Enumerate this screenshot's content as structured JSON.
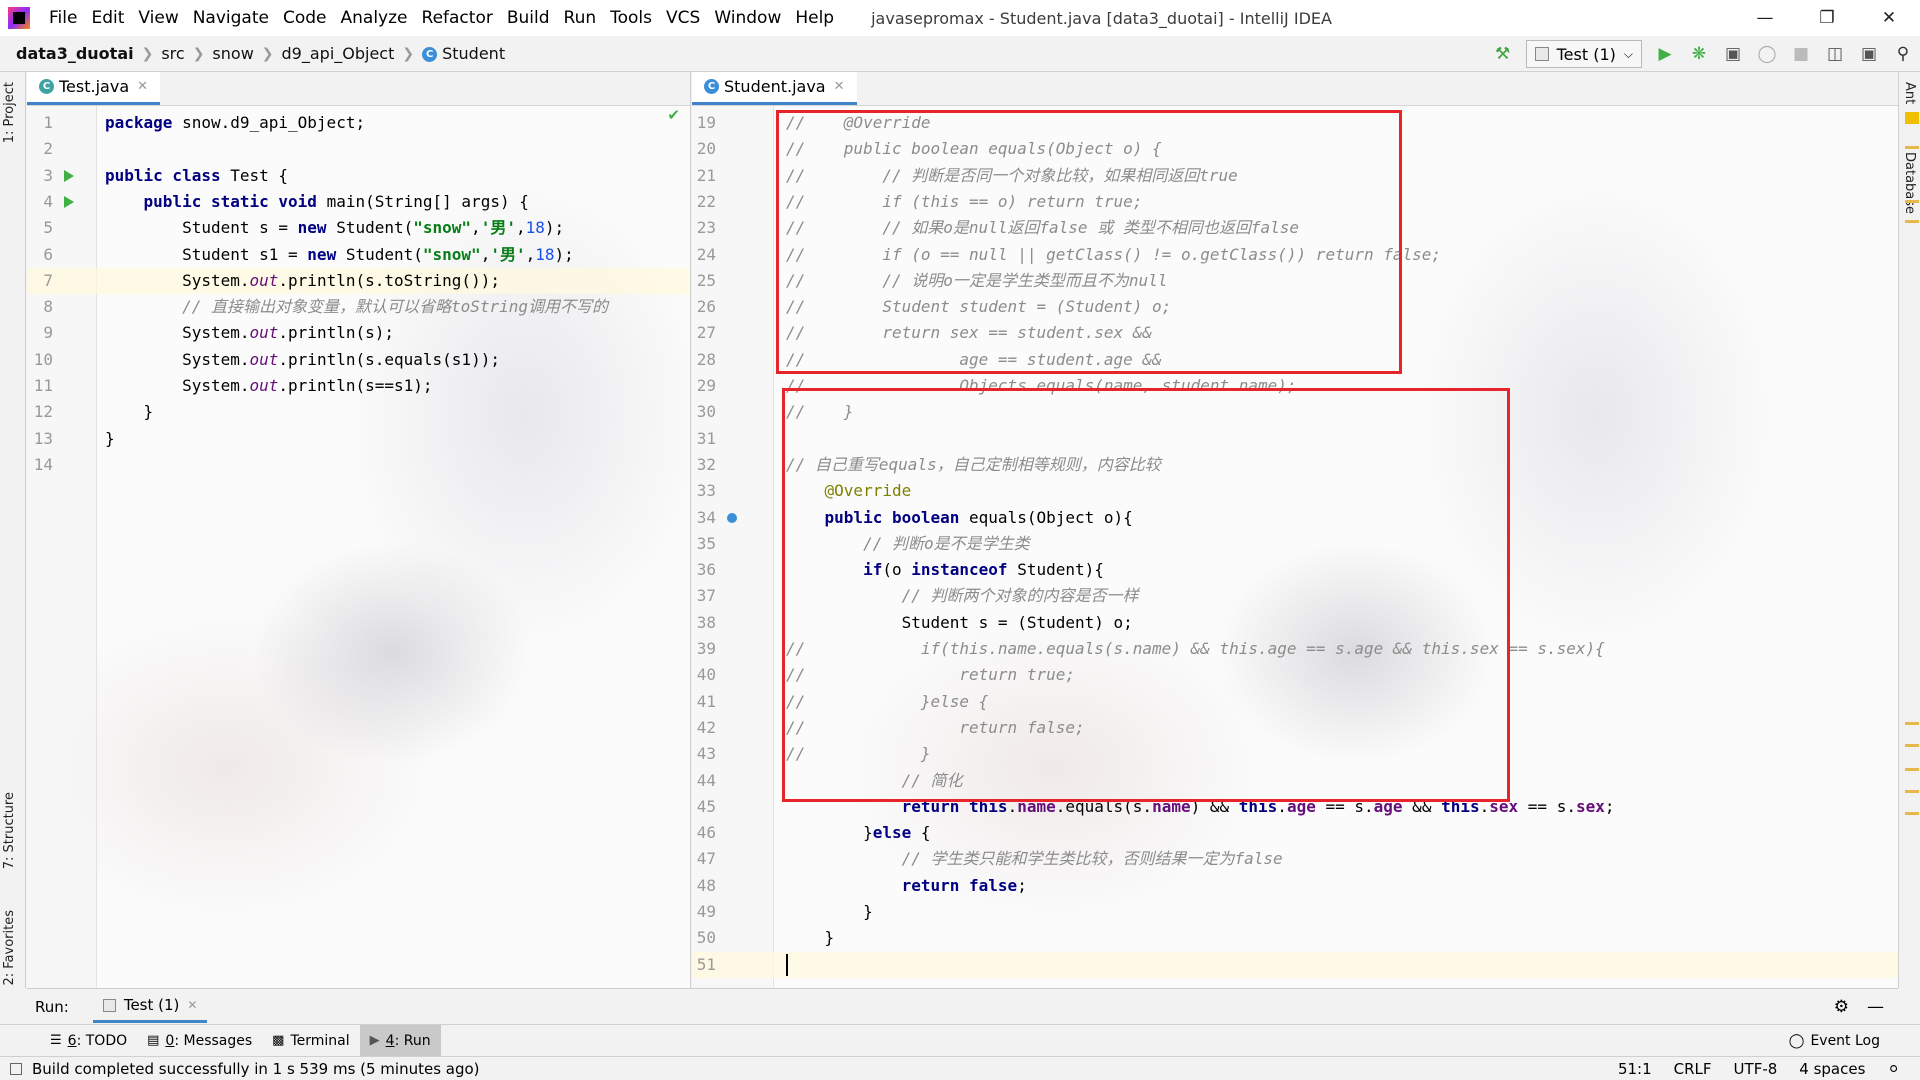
{
  "app": {
    "window_title": "javasepromax - Student.java [data3_duotai] - IntelliJ IDEA"
  },
  "menu": [
    "File",
    "Edit",
    "View",
    "Navigate",
    "Code",
    "Analyze",
    "Refactor",
    "Build",
    "Run",
    "Tools",
    "VCS",
    "Window",
    "Help"
  ],
  "breadcrumbs": [
    "data3_duotai",
    "src",
    "snow",
    "d9_api_Object",
    "Student"
  ],
  "toolbar": {
    "run_config": "Test (1)"
  },
  "left_strip": {
    "project": "1: Project",
    "structure": "7: Structure",
    "favorites": "2: Favorites"
  },
  "right_strip": {
    "ant": "Ant",
    "database": "Database"
  },
  "left_editor": {
    "tab": "Test.java",
    "lines": [
      {
        "n": "1",
        "tokens": [
          [
            "kw",
            "package "
          ],
          [
            "plain",
            "snow.d9_api_Object;"
          ]
        ]
      },
      {
        "n": "2",
        "tokens": []
      },
      {
        "n": "3",
        "tokens": [
          [
            "kw",
            "public class "
          ],
          [
            "plain",
            "Test {"
          ]
        ]
      },
      {
        "n": "4",
        "tokens": [
          [
            "plain",
            "    "
          ],
          [
            "kw",
            "public static void "
          ],
          [
            "plain",
            "main(String[] args) {"
          ]
        ]
      },
      {
        "n": "5",
        "tokens": [
          [
            "plain",
            "        Student s = "
          ],
          [
            "kw",
            "new "
          ],
          [
            "plain",
            "Student("
          ],
          [
            "str",
            "\"snow\""
          ],
          [
            "plain",
            ","
          ],
          [
            "str",
            "'男'"
          ],
          [
            "plain",
            ","
          ],
          [
            "num",
            "18"
          ],
          [
            "plain",
            ");"
          ]
        ]
      },
      {
        "n": "6",
        "tokens": [
          [
            "plain",
            "        Student s1 = "
          ],
          [
            "kw",
            "new "
          ],
          [
            "plain",
            "Student("
          ],
          [
            "str",
            "\"snow\""
          ],
          [
            "plain",
            ","
          ],
          [
            "str",
            "'男'"
          ],
          [
            "plain",
            ","
          ],
          [
            "num",
            "18"
          ],
          [
            "plain",
            ");"
          ]
        ]
      },
      {
        "n": "7",
        "tokens": [
          [
            "plain",
            "        System."
          ],
          [
            "st-it",
            "out"
          ],
          [
            "plain",
            ".println(s.toString());"
          ]
        ]
      },
      {
        "n": "8",
        "tokens": [
          [
            "plain",
            "        "
          ],
          [
            "cm",
            "// 直接输出对象变量，默认可以省略toString调用不写的"
          ]
        ]
      },
      {
        "n": "9",
        "tokens": [
          [
            "plain",
            "        System."
          ],
          [
            "st-it",
            "out"
          ],
          [
            "plain",
            ".println(s);"
          ]
        ]
      },
      {
        "n": "10",
        "tokens": [
          [
            "plain",
            "        System."
          ],
          [
            "st-it",
            "out"
          ],
          [
            "plain",
            ".println(s.equals(s1));"
          ]
        ]
      },
      {
        "n": "11",
        "tokens": [
          [
            "plain",
            "        System."
          ],
          [
            "st-it",
            "out"
          ],
          [
            "plain",
            ".println(s==s1);"
          ]
        ]
      },
      {
        "n": "12",
        "tokens": [
          [
            "plain",
            "    }"
          ]
        ]
      },
      {
        "n": "13",
        "tokens": [
          [
            "plain",
            "}"
          ]
        ]
      },
      {
        "n": "14",
        "tokens": []
      }
    ]
  },
  "right_editor": {
    "tab": "Student.java",
    "lines": [
      {
        "n": "19",
        "tokens": [
          [
            "dim",
            "//    @Override"
          ]
        ]
      },
      {
        "n": "20",
        "tokens": [
          [
            "dim",
            "//    public boolean equals(Object o) {"
          ]
        ]
      },
      {
        "n": "21",
        "tokens": [
          [
            "dim",
            "//        // 判断是否同一个对象比较，如果相同返回true"
          ]
        ]
      },
      {
        "n": "22",
        "tokens": [
          [
            "dim",
            "//        if (this == o) return true;"
          ]
        ]
      },
      {
        "n": "23",
        "tokens": [
          [
            "dim",
            "//        // 如果o是null返回false 或 类型不相同也返回false"
          ]
        ]
      },
      {
        "n": "24",
        "tokens": [
          [
            "dim",
            "//        if (o == null || getClass() != o.getClass()) return false;"
          ]
        ]
      },
      {
        "n": "25",
        "tokens": [
          [
            "dim",
            "//        // 说明o一定是学生类型而且不为null"
          ]
        ]
      },
      {
        "n": "26",
        "tokens": [
          [
            "dim",
            "//        Student student = (Student) o;"
          ]
        ]
      },
      {
        "n": "27",
        "tokens": [
          [
            "dim",
            "//        return sex == student.sex &&"
          ]
        ]
      },
      {
        "n": "28",
        "tokens": [
          [
            "dim",
            "//                age == student.age &&"
          ]
        ]
      },
      {
        "n": "29",
        "tokens": [
          [
            "dim",
            "//                Objects.equals(name, student.name);"
          ]
        ]
      },
      {
        "n": "30",
        "tokens": [
          [
            "dim",
            "//    }"
          ]
        ]
      },
      {
        "n": "31",
        "tokens": []
      },
      {
        "n": "32",
        "tokens": [
          [
            "cm",
            "// 自己重写equals，自己定制相等规则，内容比较"
          ]
        ]
      },
      {
        "n": "33",
        "tokens": [
          [
            "plain",
            "    "
          ],
          [
            "an",
            "@Override"
          ]
        ]
      },
      {
        "n": "34",
        "tokens": [
          [
            "plain",
            "    "
          ],
          [
            "kw",
            "public boolean "
          ],
          [
            "plain",
            "equals(Object o){"
          ]
        ]
      },
      {
        "n": "35",
        "tokens": [
          [
            "plain",
            "        "
          ],
          [
            "cm",
            "// 判断o是不是学生类"
          ]
        ]
      },
      {
        "n": "36",
        "tokens": [
          [
            "plain",
            "        "
          ],
          [
            "kw",
            "if"
          ],
          [
            "plain",
            "(o "
          ],
          [
            "kw",
            "instanceof "
          ],
          [
            "plain",
            "Student){"
          ]
        ]
      },
      {
        "n": "37",
        "tokens": [
          [
            "plain",
            "            "
          ],
          [
            "cm",
            "// 判断两个对象的内容是否一样"
          ]
        ]
      },
      {
        "n": "38",
        "tokens": [
          [
            "plain",
            "            Student s = (Student) o;"
          ]
        ]
      },
      {
        "n": "39",
        "tokens": [
          [
            "dim",
            "//            if(this.name.equals(s.name) && this.age == s.age && this.sex == s.sex){"
          ]
        ]
      },
      {
        "n": "40",
        "tokens": [
          [
            "dim",
            "//                return true;"
          ]
        ]
      },
      {
        "n": "41",
        "tokens": [
          [
            "dim",
            "//            }else {"
          ]
        ]
      },
      {
        "n": "42",
        "tokens": [
          [
            "dim",
            "//                return false;"
          ]
        ]
      },
      {
        "n": "43",
        "tokens": [
          [
            "dim",
            "//            }"
          ]
        ]
      },
      {
        "n": "44",
        "tokens": [
          [
            "plain",
            "            "
          ],
          [
            "cm",
            "// 简化"
          ]
        ]
      },
      {
        "n": "45",
        "tokens": [
          [
            "plain",
            "            "
          ],
          [
            "kw",
            "return this"
          ],
          [
            "plain",
            "."
          ],
          [
            "fld",
            "name"
          ],
          [
            "plain",
            ".equals(s."
          ],
          [
            "fld",
            "name"
          ],
          [
            "plain",
            ") && "
          ],
          [
            "kw",
            "this"
          ],
          [
            "plain",
            "."
          ],
          [
            "fld",
            "age"
          ],
          [
            "plain",
            " == s."
          ],
          [
            "fld",
            "age"
          ],
          [
            "plain",
            " && "
          ],
          [
            "kw",
            "this"
          ],
          [
            "plain",
            "."
          ],
          [
            "fld",
            "sex"
          ],
          [
            "plain",
            " == s."
          ],
          [
            "fld",
            "sex"
          ],
          [
            "plain",
            ";"
          ]
        ]
      },
      {
        "n": "46",
        "tokens": [
          [
            "plain",
            "        }"
          ],
          [
            "kw",
            "else "
          ],
          [
            "plain",
            "{"
          ]
        ]
      },
      {
        "n": "47",
        "tokens": [
          [
            "plain",
            "            "
          ],
          [
            "cm",
            "// 学生类只能和学生类比较，否则结果一定为false"
          ]
        ]
      },
      {
        "n": "48",
        "tokens": [
          [
            "plain",
            "            "
          ],
          [
            "kw",
            "return false"
          ],
          [
            "plain",
            ";"
          ]
        ]
      },
      {
        "n": "49",
        "tokens": [
          [
            "plain",
            "        }"
          ]
        ]
      },
      {
        "n": "50",
        "tokens": [
          [
            "plain",
            "    }"
          ]
        ]
      },
      {
        "n": "51",
        "tokens": []
      }
    ]
  },
  "run_panel": {
    "label": "Run:",
    "tab": "Test (1)"
  },
  "tool_tabs": [
    {
      "num": "6",
      "label": ": TODO"
    },
    {
      "num": "0",
      "label": ": Messages"
    },
    {
      "num": "",
      "label": "Terminal"
    },
    {
      "num": "4",
      "label": ": Run"
    }
  ],
  "event_log": "Event Log",
  "status": {
    "message": "Build completed successfully in 1 s 539 ms (5 minutes ago)",
    "position": "51:1",
    "line_sep": "CRLF",
    "encoding": "UTF-8",
    "indent": "4 spaces"
  },
  "colors": {
    "highlight_box": "#e8242a",
    "keyword": "#000080",
    "string": "#067d17",
    "comment": "#8c8c8c"
  }
}
